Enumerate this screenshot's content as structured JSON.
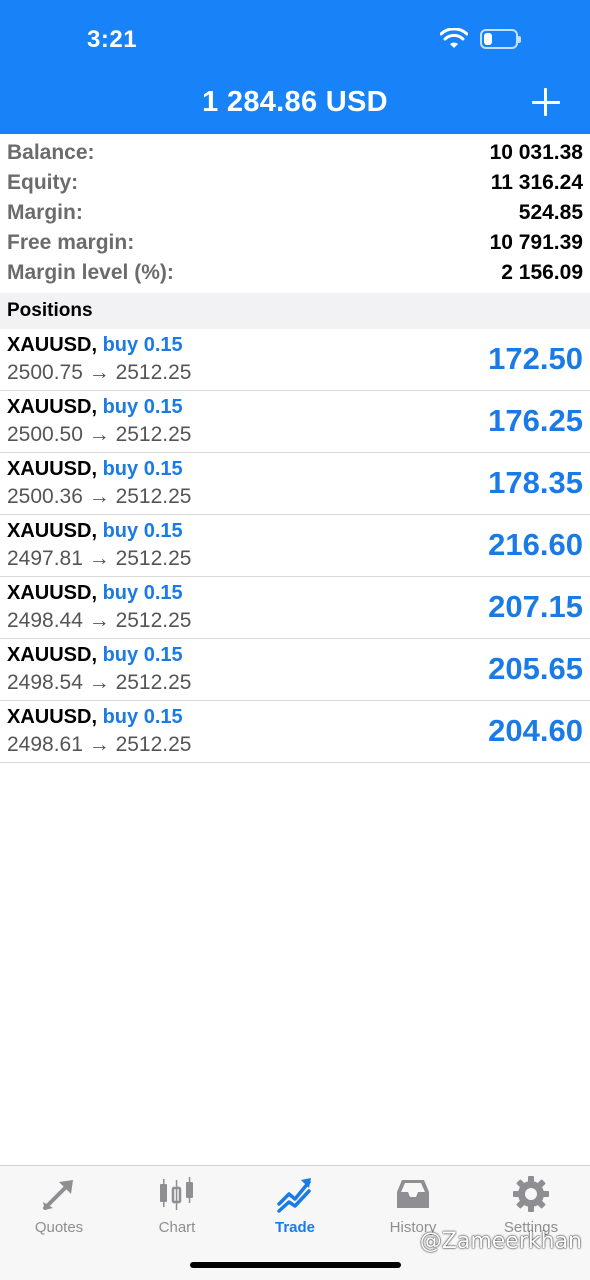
{
  "status_bar": {
    "time": "3:21"
  },
  "header": {
    "title": "1 284.86 USD",
    "add_icon": "plus-icon"
  },
  "summary": [
    {
      "label": "Balance:",
      "value": "10 031.38"
    },
    {
      "label": "Equity:",
      "value": "11 316.24"
    },
    {
      "label": "Margin:",
      "value": "524.85"
    },
    {
      "label": "Free margin:",
      "value": "10 791.39"
    },
    {
      "label": "Margin level (%):",
      "value": "2 156.09"
    }
  ],
  "positions_header": "Positions",
  "positions": [
    {
      "symbol": "XAUUSD,",
      "side": "buy 0.15",
      "prices": "2500.75 → 2512.25",
      "profit": "172.50"
    },
    {
      "symbol": "XAUUSD,",
      "side": "buy 0.15",
      "prices": "2500.50 → 2512.25",
      "profit": "176.25"
    },
    {
      "symbol": "XAUUSD,",
      "side": "buy 0.15",
      "prices": "2500.36 → 2512.25",
      "profit": "178.35"
    },
    {
      "symbol": "XAUUSD,",
      "side": "buy 0.15",
      "prices": "2497.81 → 2512.25",
      "profit": "216.60"
    },
    {
      "symbol": "XAUUSD,",
      "side": "buy 0.15",
      "prices": "2498.44 → 2512.25",
      "profit": "207.15"
    },
    {
      "symbol": "XAUUSD,",
      "side": "buy 0.15",
      "prices": "2498.54 → 2512.25",
      "profit": "205.65"
    },
    {
      "symbol": "XAUUSD,",
      "side": "buy 0.15",
      "prices": "2498.61 → 2512.25",
      "profit": "204.60"
    }
  ],
  "tabs": [
    {
      "label": "Quotes",
      "icon": "quotes-icon",
      "active": false
    },
    {
      "label": "Chart",
      "icon": "candlestick-icon",
      "active": false
    },
    {
      "label": "Trade",
      "icon": "trade-icon",
      "active": true
    },
    {
      "label": "History",
      "icon": "inbox-icon",
      "active": false
    },
    {
      "label": "Settings",
      "icon": "gear-icon",
      "active": false
    }
  ],
  "watermark": "@Zameerkhan",
  "colors": {
    "header_bg": "#1882f8",
    "accent": "#1a7be6",
    "muted": "#8e8e93"
  }
}
